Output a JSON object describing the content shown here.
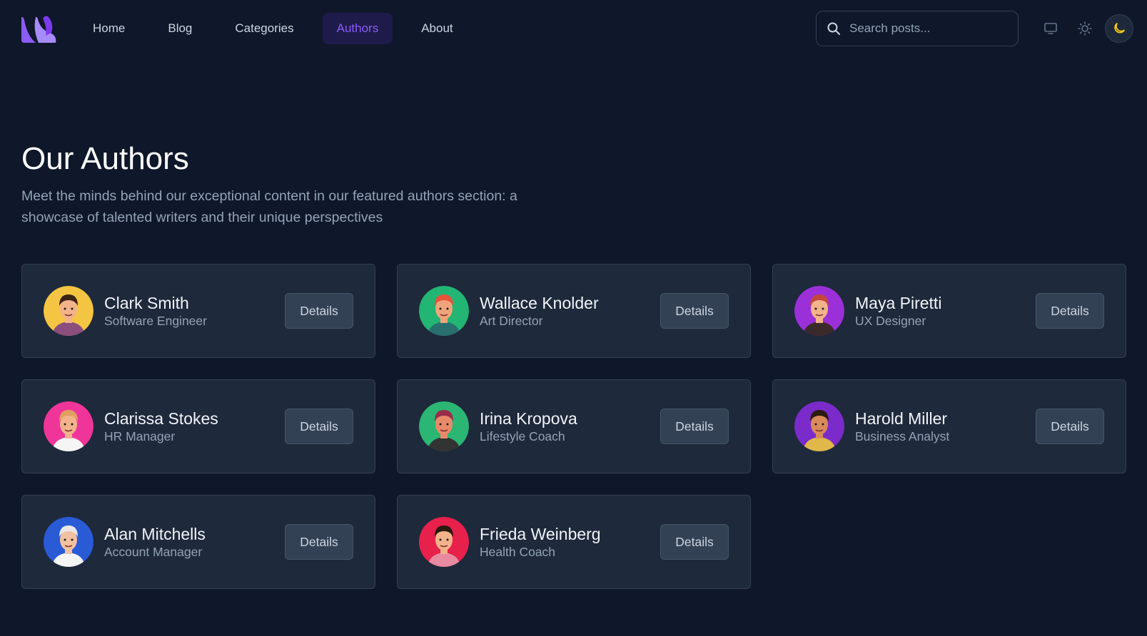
{
  "nav": {
    "items": [
      {
        "label": "Home",
        "active": false
      },
      {
        "label": "Blog",
        "active": false
      },
      {
        "label": "Categories",
        "active": false
      },
      {
        "label": "Authors",
        "active": true
      },
      {
        "label": "About",
        "active": false
      }
    ]
  },
  "search": {
    "placeholder": "Search posts...",
    "value": ""
  },
  "theme": {
    "options": [
      "system-icon",
      "sun-icon",
      "moon-icon"
    ],
    "selected": "moon-icon"
  },
  "page": {
    "title": "Our Authors",
    "subtitle": "Meet the minds behind our exceptional content in our featured authors section: a showcase of talented writers and their unique perspectives"
  },
  "authors": [
    {
      "name": "Clark Smith",
      "role": "Software Engineer",
      "button": "Details",
      "avatar_bg": "#f4c542",
      "skin": "#f2b38a",
      "hair": "#3b2414",
      "shirt": "#8a4f7d"
    },
    {
      "name": "Wallace Knolder",
      "role": "Art Director",
      "button": "Details",
      "avatar_bg": "#22b573",
      "skin": "#f0a47a",
      "hair": "#e8543a",
      "shirt": "#2a6f6f"
    },
    {
      "name": "Maya Piretti",
      "role": "UX Designer",
      "button": "Details",
      "avatar_bg": "#9b30d9",
      "skin": "#f2b38a",
      "hair": "#c2483c",
      "shirt": "#3a2a2a"
    },
    {
      "name": "Clarissa Stokes",
      "role": "HR Manager",
      "button": "Details",
      "avatar_bg": "#f0359a",
      "skin": "#f2b38a",
      "hair": "#e0a060",
      "shirt": "#f5f5f5"
    },
    {
      "name": "Irina Kropova",
      "role": "Lifestyle Coach",
      "button": "Details",
      "avatar_bg": "#2bb673",
      "skin": "#e88a6a",
      "hair": "#9a2a4a",
      "shirt": "#333333"
    },
    {
      "name": "Harold Miller",
      "role": "Business Analyst",
      "button": "Details",
      "avatar_bg": "#7b2bc9",
      "skin": "#d98a5a",
      "hair": "#2a1a10",
      "shirt": "#e0b84a"
    },
    {
      "name": "Alan Mitchells",
      "role": "Account Manager",
      "button": "Details",
      "avatar_bg": "#2a5bd7",
      "skin": "#f2c1a0",
      "hair": "#e8e8e8",
      "shirt": "#f5f5f5"
    },
    {
      "name": "Frieda Weinberg",
      "role": "Health Coach",
      "button": "Details",
      "avatar_bg": "#e8214c",
      "skin": "#f2b38a",
      "hair": "#2a1a10",
      "shirt": "#e88aa0"
    }
  ]
}
